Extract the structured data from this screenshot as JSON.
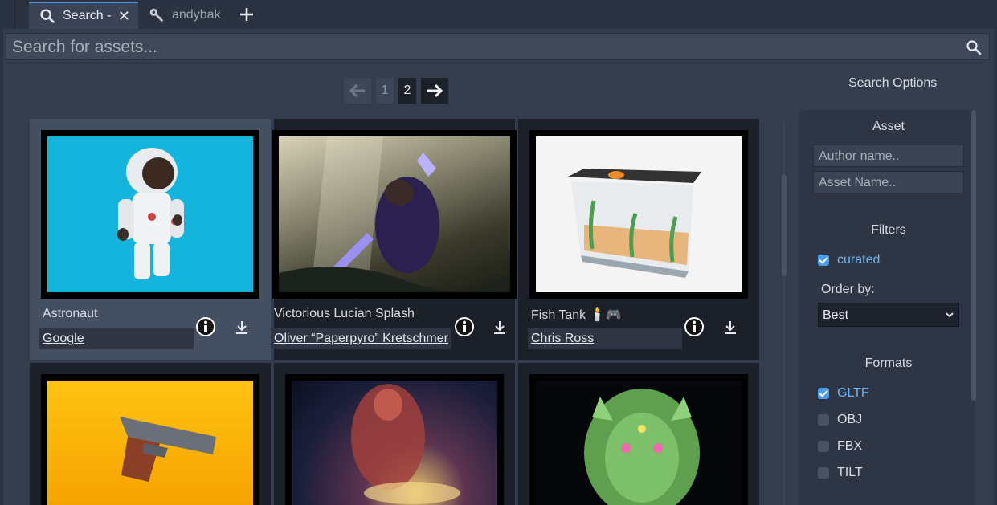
{
  "tabs": [
    {
      "label": "Search -",
      "active": true,
      "icon": "search-icon",
      "close": "✕"
    },
    {
      "label": "andybak",
      "active": false,
      "icon": "key-icon"
    }
  ],
  "add_tab_icon": "plus-icon",
  "search": {
    "placeholder": "Search for assets...",
    "value": "",
    "icon": "search-icon"
  },
  "pagination": {
    "prev_icon": "arrow-left-icon",
    "pages": [
      "1",
      "2"
    ],
    "current": "2",
    "next_icon": "arrow-right-icon"
  },
  "assets": [
    {
      "title": "Astronaut",
      "author": "Google"
    },
    {
      "title": "Victorious Lucian Splash",
      "author": "Oliver “Paperpyro” Kretschmer"
    },
    {
      "title": "Fish Tank 🕯️🎮",
      "author": "Chris Ross"
    },
    {
      "title": "",
      "author": ""
    },
    {
      "title": "",
      "author": ""
    },
    {
      "title": "",
      "author": ""
    }
  ],
  "options": {
    "title": "Search Options",
    "asset_section": "Asset",
    "author_placeholder": "Author name..",
    "asset_name_placeholder": "Asset Name..",
    "filters_section": "Filters",
    "curated_label": "curated",
    "curated_checked": true,
    "order_label": "Order by:",
    "order_value": "Best",
    "formats_section": "Formats",
    "formats": [
      {
        "label": "GLTF",
        "checked": true
      },
      {
        "label": "OBJ",
        "checked": false
      },
      {
        "label": "FBX",
        "checked": false
      },
      {
        "label": "TILT",
        "checked": false
      }
    ]
  },
  "colors": {
    "accent": "#4f9ce6",
    "background": "#343d4e",
    "card": "#1c2029"
  }
}
